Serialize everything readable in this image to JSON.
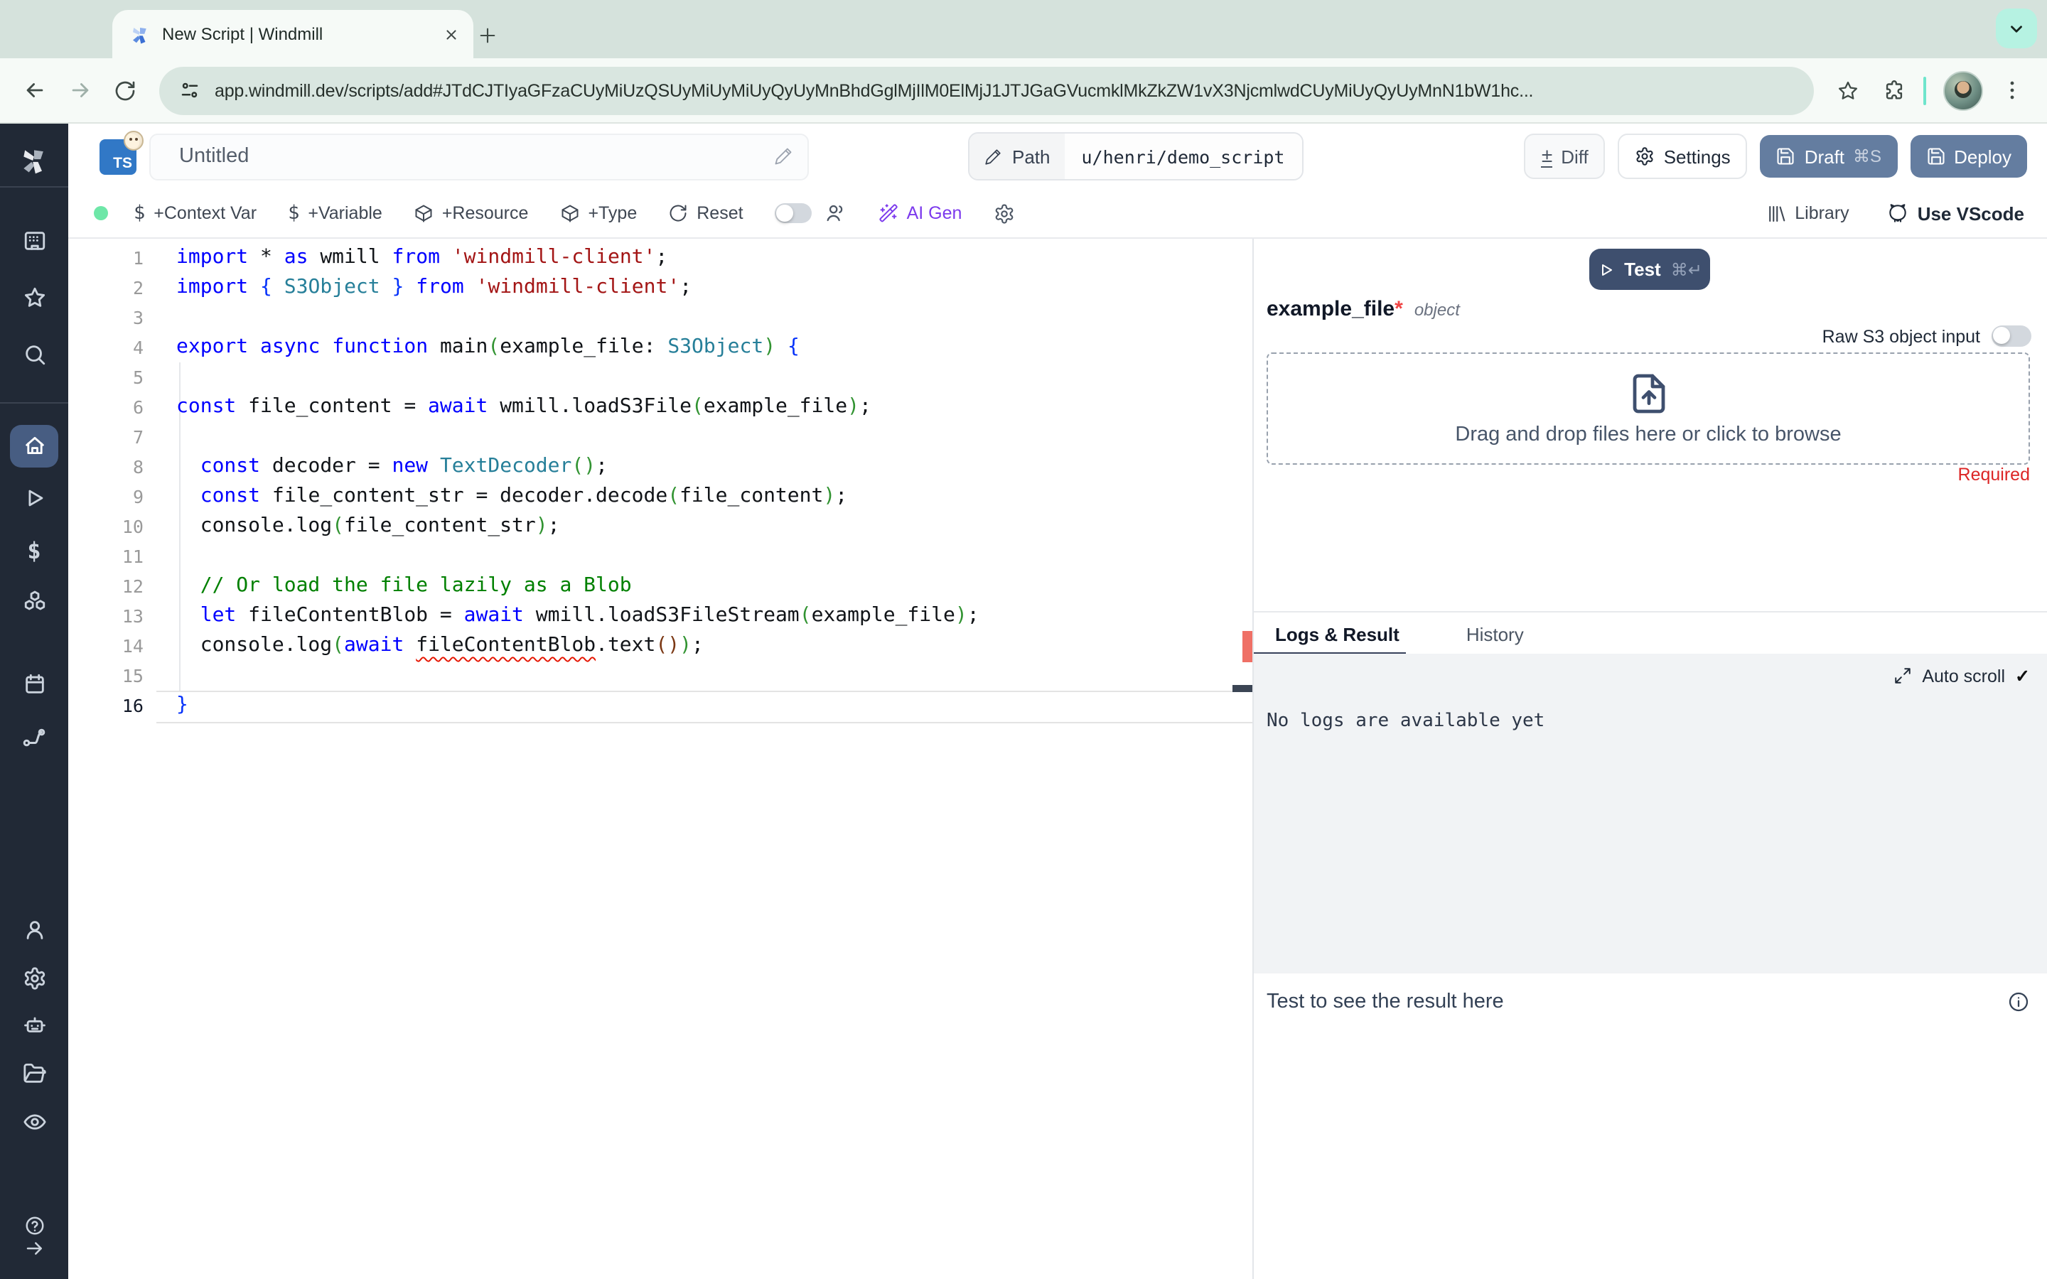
{
  "browser": {
    "tab_title": "New Script | Windmill",
    "url": "app.windmill.dev/scripts/add#JTdCJTIyaGFzaCUyMiUzQSUyMiUyMiUyQyUyMnBhdGglMjIlM0ElMjJ1JTJGaGVucmklMkZkZW1vX3NjcmlwdCUyMiUyQyUyMnN1bW1hc..."
  },
  "header": {
    "language_badge": "TS",
    "title": "Untitled",
    "path_label": "Path",
    "path_value": "u/henri/demo_script",
    "diff_label": "Diff",
    "settings_label": "Settings",
    "draft_label": "Draft",
    "draft_shortcut": "⌘S",
    "deploy_label": "Deploy"
  },
  "toolbar": {
    "context_var": "+Context Var",
    "variable": "+Variable",
    "resource": "+Resource",
    "type": "+Type",
    "reset": "Reset",
    "ai_gen": "AI Gen",
    "library": "Library",
    "use_vscode": "Use VScode"
  },
  "editor": {
    "active_line": 16,
    "lines": [
      [
        [
          "kw",
          "import"
        ],
        [
          "pl",
          " * "
        ],
        [
          "kw",
          "as"
        ],
        [
          "pl",
          " wmill "
        ],
        [
          "kw",
          "from"
        ],
        [
          "pl",
          " "
        ],
        [
          "str",
          "'windmill-client'"
        ],
        [
          "pl",
          ";"
        ]
      ],
      [
        [
          "kw",
          "import"
        ],
        [
          "pl",
          " "
        ],
        [
          "b1",
          "{"
        ],
        [
          "pl",
          " "
        ],
        [
          "ty",
          "S3Object"
        ],
        [
          "pl",
          " "
        ],
        [
          "b1",
          "}"
        ],
        [
          "pl",
          " "
        ],
        [
          "kw",
          "from"
        ],
        [
          "pl",
          " "
        ],
        [
          "str",
          "'windmill-client'"
        ],
        [
          "pl",
          ";"
        ]
      ],
      [],
      [
        [
          "kw",
          "export"
        ],
        [
          "pl",
          " "
        ],
        [
          "kw",
          "async"
        ],
        [
          "pl",
          " "
        ],
        [
          "kw",
          "function"
        ],
        [
          "pl",
          " main"
        ],
        [
          "b2",
          "("
        ],
        [
          "pl",
          "example_file: "
        ],
        [
          "ty",
          "S3Object"
        ],
        [
          "b2",
          ")"
        ],
        [
          "pl",
          " "
        ],
        [
          "b1",
          "{"
        ]
      ],
      [],
      [
        [
          "kw",
          "const"
        ],
        [
          "pl",
          " file_content = "
        ],
        [
          "kw",
          "await"
        ],
        [
          "pl",
          " wmill.loadS3File"
        ],
        [
          "b2",
          "("
        ],
        [
          "pl",
          "example_file"
        ],
        [
          "b2",
          ")"
        ],
        [
          "pl",
          ";"
        ]
      ],
      [],
      [
        [
          "pl",
          "  "
        ],
        [
          "kw",
          "const"
        ],
        [
          "pl",
          " decoder = "
        ],
        [
          "kw",
          "new"
        ],
        [
          "pl",
          " "
        ],
        [
          "ty",
          "TextDecoder"
        ],
        [
          "b2",
          "("
        ],
        [
          "b2",
          ")"
        ],
        [
          "pl",
          ";"
        ]
      ],
      [
        [
          "pl",
          "  "
        ],
        [
          "kw",
          "const"
        ],
        [
          "pl",
          " file_content_str = decoder.decode"
        ],
        [
          "b2",
          "("
        ],
        [
          "pl",
          "file_content"
        ],
        [
          "b2",
          ")"
        ],
        [
          "pl",
          ";"
        ]
      ],
      [
        [
          "pl",
          "  console.log"
        ],
        [
          "b2",
          "("
        ],
        [
          "pl",
          "file_content_str"
        ],
        [
          "b2",
          ")"
        ],
        [
          "pl",
          ";"
        ]
      ],
      [],
      [
        [
          "cm",
          "  // Or load the file lazily as a Blob"
        ]
      ],
      [
        [
          "pl",
          "  "
        ],
        [
          "kw",
          "let"
        ],
        [
          "pl",
          " fileContentBlob = "
        ],
        [
          "kw",
          "await"
        ],
        [
          "pl",
          " wmill.loadS3FileStream"
        ],
        [
          "b2",
          "("
        ],
        [
          "pl",
          "example_file"
        ],
        [
          "b2",
          ")"
        ],
        [
          "pl",
          ";"
        ]
      ],
      [
        [
          "pl",
          "  console.log"
        ],
        [
          "b2",
          "("
        ],
        [
          "kw",
          "await"
        ],
        [
          "pl",
          " "
        ],
        [
          "err",
          "fileContentBlob"
        ],
        [
          "pl",
          ".text"
        ],
        [
          "b3",
          "("
        ],
        [
          "b3",
          ")"
        ],
        [
          "b2",
          ")"
        ],
        [
          "pl",
          ";"
        ]
      ],
      [],
      [
        [
          "b1",
          "}"
        ]
      ]
    ]
  },
  "run_panel": {
    "test_label": "Test",
    "test_shortcut": "⌘↵",
    "arg_name": "example_file",
    "arg_required_star": "*",
    "arg_type": "object",
    "raw_s3_label": "Raw S3 object input",
    "dropzone_text": "Drag and drop files here or click to browse",
    "required_label": "Required",
    "tab_logs": "Logs & Result",
    "tab_history": "History",
    "auto_scroll_label": "Auto scroll",
    "auto_scroll_check": "✓",
    "no_logs_text": "No logs are available yet",
    "result_placeholder": "Test to see the result here"
  },
  "colors": {
    "accent_slate_button": "#647da0",
    "test_button": "#3e4f6e",
    "ai_gen_purple": "#7c3aed",
    "status_dot_green": "#6ee7a8",
    "error_red": "#e51400",
    "required_red": "#dc2626",
    "sidebar_bg": "#212936",
    "chrome_bg": "#d5e2dc"
  }
}
